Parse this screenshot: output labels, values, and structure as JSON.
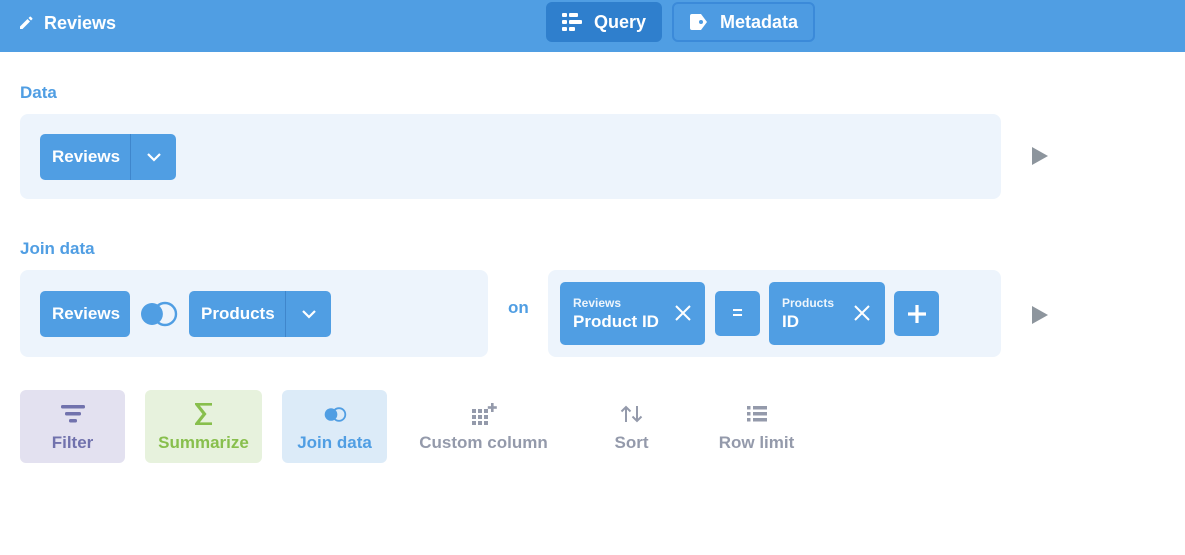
{
  "header": {
    "title": "Reviews",
    "tabs": [
      {
        "label": "Query",
        "active": true
      },
      {
        "label": "Metadata",
        "active": false
      }
    ]
  },
  "data_section": {
    "label": "Data",
    "source_table": "Reviews"
  },
  "join_section": {
    "label": "Join data",
    "left_table": "Reviews",
    "right_table": "Products",
    "on_label": "on",
    "condition": {
      "left": {
        "table": "Reviews",
        "field": "Product ID"
      },
      "operator": "=",
      "right": {
        "table": "Products",
        "field": "ID"
      }
    }
  },
  "actions": [
    {
      "label": "Filter",
      "icon": "filter-icon"
    },
    {
      "label": "Summarize",
      "icon": "sigma-icon"
    },
    {
      "label": "Join data",
      "icon": "join-icon"
    },
    {
      "label": "Custom column",
      "icon": "add-column-icon"
    },
    {
      "label": "Sort",
      "icon": "sort-icon"
    },
    {
      "label": "Row limit",
      "icon": "list-icon"
    }
  ],
  "colors": {
    "brand": "#509ee3",
    "filter_bg": "#e3e1f0",
    "filter_fg": "#7172ad",
    "summarize_bg": "#e7f2dd",
    "summarize_fg": "#88bf4d",
    "join_bg": "#dcebf8",
    "join_fg": "#509ee3",
    "muted": "#949aab"
  }
}
